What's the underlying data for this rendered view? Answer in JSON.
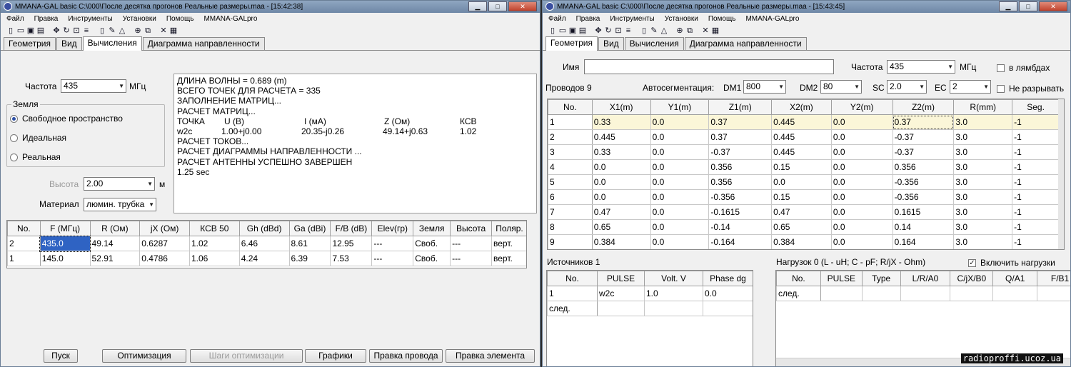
{
  "left": {
    "title": "MMANA-GAL basic C:\\000\\После десятка прогонов Реальные размеры.maa - [15:42:38]",
    "menu": [
      "Файл",
      "Правка",
      "Инструменты",
      "Установки",
      "Помощь",
      "MMANA-GALpro"
    ],
    "tabs": [
      "Геометрия",
      "Вид",
      "Вычисления",
      "Диаграмма направленности"
    ],
    "active_tab": "Вычисления",
    "freq_label": "Частота",
    "freq_value": "435",
    "freq_unit": "МГц",
    "ground_title": "Земля",
    "ground_options": [
      "Свободное пространство",
      "Идеальная",
      "Реальная"
    ],
    "ground_selected": "Свободное пространство",
    "height_label": "Высота",
    "height_value": "2.00",
    "height_unit": "м",
    "material_label": "Материал",
    "material_value": "люмин. трубка",
    "log_lines": [
      "ДЛИНА ВОЛНЫ = 0.689 (m)",
      "ВСЕГО ТОЧЕК ДЛЯ РАСЧЕТА = 335",
      "ЗАПОЛНЕНИЕ МАТРИЦ...",
      "РАСЧЕТ МАТРИЦ..."
    ],
    "log_table": {
      "header": [
        "ТОЧКА",
        "U (B)",
        "I (мА)",
        "Z (Ом)",
        "КСВ"
      ],
      "row": [
        "w2c",
        "1.00+j0.00",
        "20.35-j0.26",
        "49.14+j0.63",
        "1.02"
      ]
    },
    "log_lines_after": [
      "РАСЧЕТ ТОКОВ...",
      "РАСЧЕТ ДИАГРАММЫ НАПРАВЛЕННОСТИ ...",
      "РАСЧЕТ АНТЕННЫ УСПЕШНО ЗАВЕРШЕН",
      "1.25 sec"
    ],
    "results_columns": [
      "No.",
      "F (МГц)",
      "R (Ом)",
      "jX (Ом)",
      "КСВ 50",
      "Gh (dBd)",
      "Ga (dBi)",
      "F/B (dB)",
      "Elev(гр)",
      "Земля",
      "Высота",
      "Поляр."
    ],
    "results_rows": [
      [
        "2",
        "435.0",
        "49.14",
        "0.6287",
        "1.02",
        "6.46",
        "8.61",
        "12.95",
        "---",
        "Своб.",
        "---",
        "верт."
      ],
      [
        "1",
        "145.0",
        "52.91",
        "0.4786",
        "1.06",
        "4.24",
        "6.39",
        "7.53",
        "---",
        "Своб.",
        "---",
        "верт."
      ]
    ],
    "buttons": {
      "start": "Пуск",
      "optimize": "Оптимизация",
      "opt_steps": "Шаги оптимизации",
      "graphs": "Графики",
      "edit_wire": "Правка провода",
      "edit_element": "Правка элемента"
    }
  },
  "right": {
    "title": "MMANA-GAL basic C:\\000\\После десятка прогонов Реальные размеры.maa - [15:43:45]",
    "menu": [
      "Файл",
      "Правка",
      "Инструменты",
      "Установки",
      "Помощь",
      "MMANA-GALpro"
    ],
    "tabs": [
      "Геометрия",
      "Вид",
      "Вычисления",
      "Диаграмма направленности"
    ],
    "active_tab": "Геометрия",
    "name_label": "Имя",
    "name_value": "",
    "freq_label": "Частота",
    "freq_value": "435",
    "freq_unit": "МГц",
    "in_lambda_label": "в лямбдах",
    "wires_label": "Проводов 9",
    "autoseg_label": "Автосегментация:",
    "dm1_label": "DM1",
    "dm1_value": "800",
    "dm2_label": "DM2",
    "dm2_value": "80",
    "sc_label": "SC",
    "sc_value": "2.0",
    "ec_label": "EC",
    "ec_value": "2",
    "no_break_label": "Не разрывать",
    "wire_columns": [
      "No.",
      "X1(m)",
      "Y1(m)",
      "Z1(m)",
      "X2(m)",
      "Y2(m)",
      "Z2(m)",
      "R(mm)",
      "Seg."
    ],
    "wire_rows": [
      [
        "1",
        "0.33",
        "0.0",
        "0.37",
        "0.445",
        "0.0",
        "0.37",
        "3.0",
        "-1"
      ],
      [
        "2",
        "0.445",
        "0.0",
        "0.37",
        "0.445",
        "0.0",
        "-0.37",
        "3.0",
        "-1"
      ],
      [
        "3",
        "0.33",
        "0.0",
        "-0.37",
        "0.445",
        "0.0",
        "-0.37",
        "3.0",
        "-1"
      ],
      [
        "4",
        "0.0",
        "0.0",
        "0.356",
        "0.15",
        "0.0",
        "0.356",
        "3.0",
        "-1"
      ],
      [
        "5",
        "0.0",
        "0.0",
        "0.356",
        "0.0",
        "0.0",
        "-0.356",
        "3.0",
        "-1"
      ],
      [
        "6",
        "0.0",
        "0.0",
        "-0.356",
        "0.15",
        "0.0",
        "-0.356",
        "3.0",
        "-1"
      ],
      [
        "7",
        "0.47",
        "0.0",
        "-0.1615",
        "0.47",
        "0.0",
        "0.1615",
        "3.0",
        "-1"
      ],
      [
        "8",
        "0.65",
        "0.0",
        "-0.14",
        "0.65",
        "0.0",
        "0.14",
        "3.0",
        "-1"
      ],
      [
        "9",
        "0.384",
        "0.0",
        "-0.164",
        "0.384",
        "0.0",
        "0.164",
        "3.0",
        "-1"
      ]
    ],
    "sources_label": "Источников 1",
    "source_columns": [
      "No.",
      "PULSE",
      "Volt. V",
      "Phase dg"
    ],
    "source_rows": [
      [
        "1",
        "w2c",
        "1.0",
        "0.0"
      ],
      [
        "след.",
        "",
        "",
        ""
      ]
    ],
    "loads_label": "Нагрузок 0 (L - uH; C - pF; R/jX - Ohm)",
    "enable_loads_label": "Включить нагрузки",
    "load_columns": [
      "No.",
      "PULSE",
      "Type",
      "L/R/A0",
      "C/jX/B0",
      "Q/A1",
      "F/B1"
    ],
    "load_rows": [
      [
        "след.",
        "",
        "",
        "",
        "",
        "",
        ""
      ]
    ],
    "watermark": "radioproffi.ucoz.ua"
  }
}
